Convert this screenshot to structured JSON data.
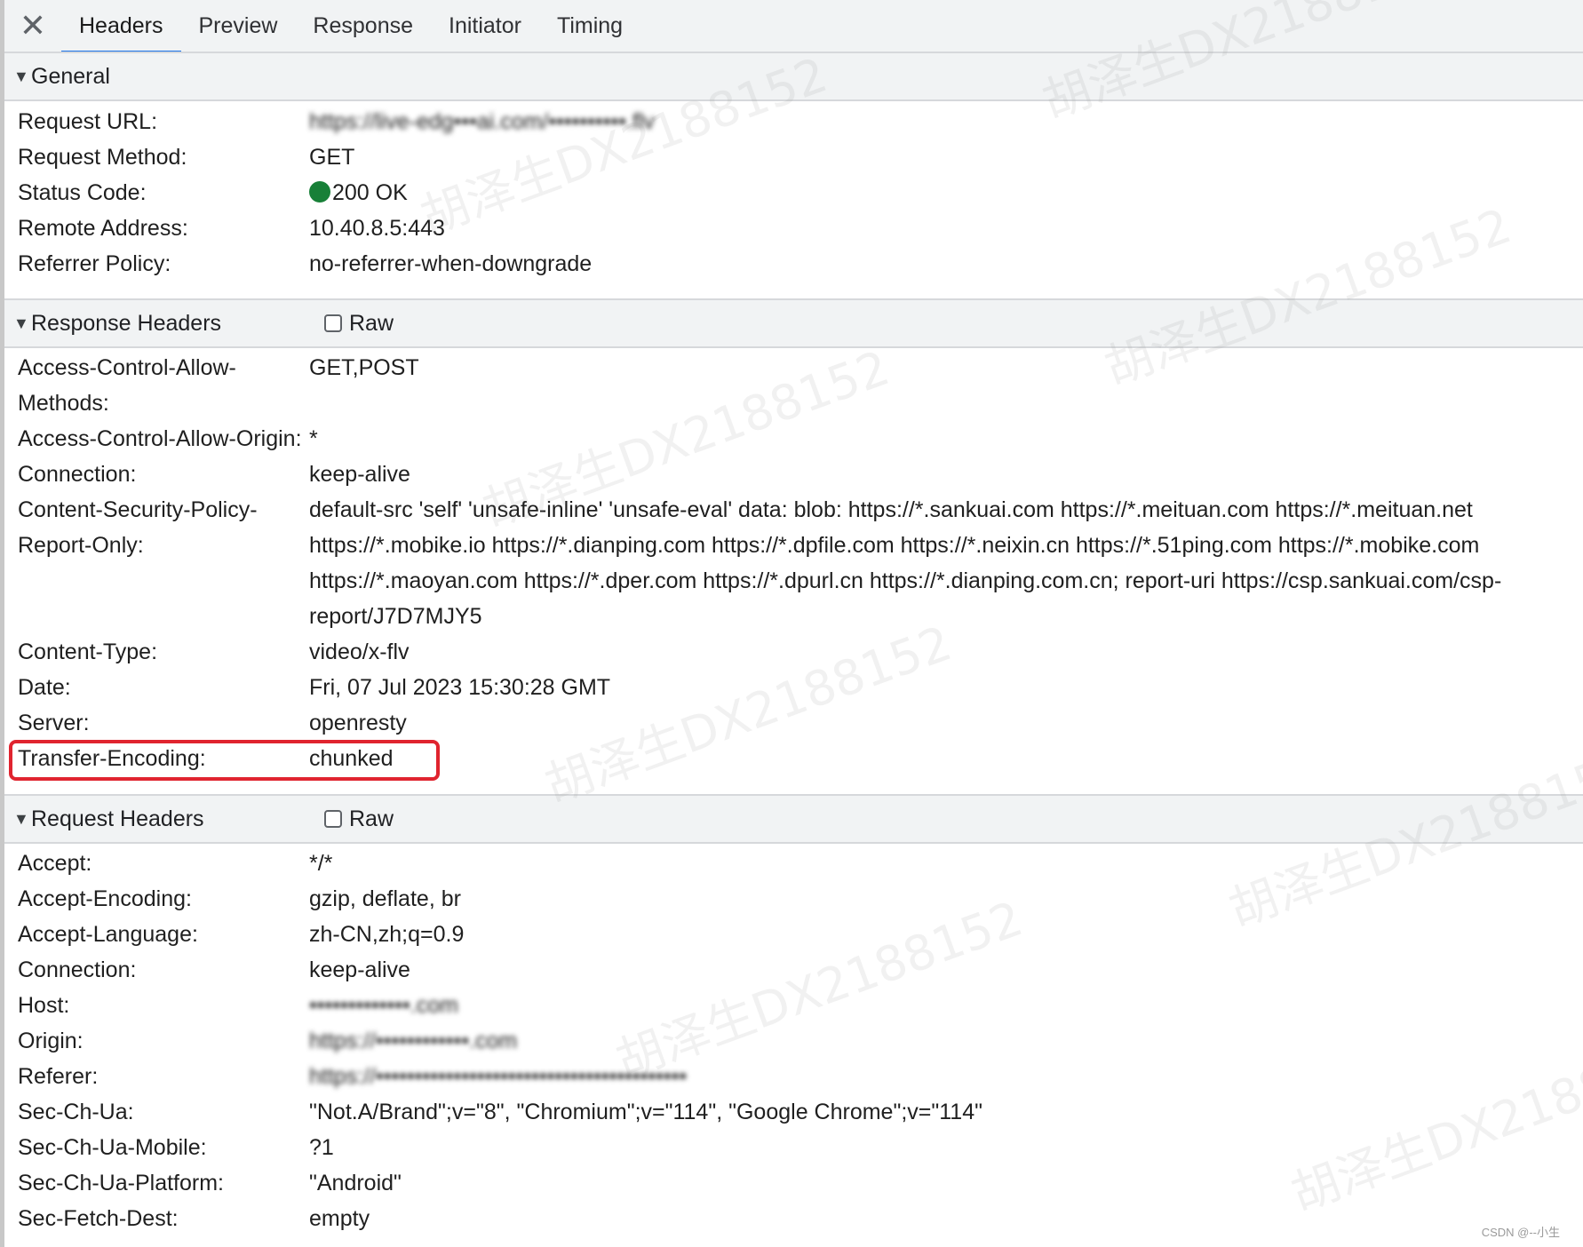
{
  "tabs": [
    "Headers",
    "Preview",
    "Response",
    "Initiator",
    "Timing"
  ],
  "active_tab": "Headers",
  "sections": {
    "general": {
      "title": "General",
      "rows": [
        {
          "key": "Request URL:",
          "value": "https://live-edg•••ai.com/••••••••••.flv",
          "blurred": true
        },
        {
          "key": "Request Method:",
          "value": "GET"
        },
        {
          "key": "Status Code:",
          "value": "200 OK",
          "status_color": "#188038"
        },
        {
          "key": "Remote Address:",
          "value": "10.40.8.5:443"
        },
        {
          "key": "Referrer Policy:",
          "value": "no-referrer-when-downgrade"
        }
      ]
    },
    "response": {
      "title": "Response Headers",
      "raw_label": "Raw",
      "rows": [
        {
          "key": "Access-Control-Allow-Methods:",
          "value": "GET,POST"
        },
        {
          "key": "Access-Control-Allow-Origin:",
          "value": "*"
        },
        {
          "key": "Connection:",
          "value": "keep-alive"
        },
        {
          "key": "Content-Security-Policy-Report-Only:",
          "value": "default-src 'self' 'unsafe-inline' 'unsafe-eval' data: blob: https://*.sankuai.com https://*.meituan.com https://*.meituan.net https://*.mobike.io https://*.dianping.com https://*.dpfile.com https://*.neixin.cn https://*.51ping.com https://*.mobike.com https://*.maoyan.com https://*.dper.com https://*.dpurl.cn https://*.dianping.com.cn; report-uri https://csp.sankuai.com/csp-report/J7D7MJY5"
        },
        {
          "key": "Content-Type:",
          "value": "video/x-flv"
        },
        {
          "key": "Date:",
          "value": "Fri, 07 Jul 2023 15:30:28 GMT"
        },
        {
          "key": "Server:",
          "value": "openresty"
        },
        {
          "key": "Transfer-Encoding:",
          "value": "chunked",
          "highlighted": true
        }
      ]
    },
    "request": {
      "title": "Request Headers",
      "raw_label": "Raw",
      "rows": [
        {
          "key": "Accept:",
          "value": "*/*"
        },
        {
          "key": "Accept-Encoding:",
          "value": "gzip, deflate, br"
        },
        {
          "key": "Accept-Language:",
          "value": "zh-CN,zh;q=0.9"
        },
        {
          "key": "Connection:",
          "value": "keep-alive"
        },
        {
          "key": "Host:",
          "value": "•••••••••••••.com",
          "blurred": true
        },
        {
          "key": "Origin:",
          "value": "https://••••••••••••.com",
          "blurred": true
        },
        {
          "key": "Referer:",
          "value": "https://••••••••••••••••••••••••••••••••••••••••",
          "blurred": true
        },
        {
          "key": "Sec-Ch-Ua:",
          "value": "\"Not.A/Brand\";v=\"8\", \"Chromium\";v=\"114\", \"Google Chrome\";v=\"114\""
        },
        {
          "key": "Sec-Ch-Ua-Mobile:",
          "value": "?1"
        },
        {
          "key": "Sec-Ch-Ua-Platform:",
          "value": "\"Android\""
        },
        {
          "key": "Sec-Fetch-Dest:",
          "value": "empty"
        }
      ]
    }
  },
  "watermark_text": "胡泽生DX2188152",
  "credit": "CSDN @--小生"
}
